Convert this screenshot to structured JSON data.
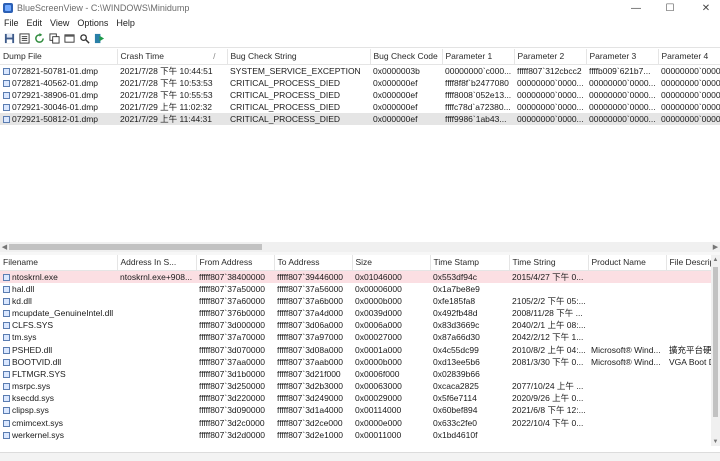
{
  "window": {
    "title": "BlueScreenView  -  C:\\WINDOWS\\Minidump"
  },
  "menu": [
    "File",
    "Edit",
    "View",
    "Options",
    "Help"
  ],
  "toolbar_icons": [
    "save-icon",
    "properties-icon",
    "refresh-icon",
    "copy-icon",
    "html-report-icon",
    "search-icon",
    "exit-icon"
  ],
  "crash_table": {
    "columns": [
      "Dump File",
      "Crash Time",
      "Bug Check String",
      "Bug Check Code",
      "Parameter 1",
      "Parameter 2",
      "Parameter 3",
      "Parameter 4"
    ],
    "sort_indicator": "/",
    "rows": [
      [
        "072821-50781-01.dmp",
        "2021/7/28 下午 10:44:51",
        "SYSTEM_SERVICE_EXCEPTION",
        "0x0000003b",
        "00000000`c000...",
        "fffff807`312cbcc2",
        "ffffb009`621b7...",
        "00000000`0000..."
      ],
      [
        "072821-40562-01.dmp",
        "2021/7/28 下午 10:53:53",
        "CRITICAL_PROCESS_DIED",
        "0x000000ef",
        "ffff8f8f`b2477080",
        "00000000`0000...",
        "00000000`0000...",
        "00000000`0000..."
      ],
      [
        "072921-38906-01.dmp",
        "2021/7/28 下午 10:55:53",
        "CRITICAL_PROCESS_DIED",
        "0x000000ef",
        "ffff8008`052e13...",
        "00000000`0000...",
        "00000000`0000...",
        "00000000`0000..."
      ],
      [
        "072921-30046-01.dmp",
        "2021/7/29 上午 11:02:32",
        "CRITICAL_PROCESS_DIED",
        "0x000000ef",
        "ffffc78d`a72380...",
        "00000000`0000...",
        "00000000`0000...",
        "00000000`0000..."
      ],
      [
        "072921-50812-01.dmp",
        "2021/7/29 上午 11:44:31",
        "CRITICAL_PROCESS_DIED",
        "0x000000ef",
        "ffff9986`1ab43...",
        "00000000`0000...",
        "00000000`0000...",
        "00000000`0000..."
      ]
    ],
    "selected_row": 4
  },
  "driver_table": {
    "columns": [
      "Filename",
      "Address In S...",
      "From Address",
      "To Address",
      "Size",
      "Time Stamp",
      "Time String",
      "Product Name",
      "File Descrip..."
    ],
    "rows": [
      [
        "ntoskrnl.exe",
        "ntoskrnl.exe+908...",
        "fffff807`38400000",
        "fffff807`39446000",
        "0x01046000",
        "0x553df94c",
        "2015/4/27 下午 0...",
        "",
        ""
      ],
      [
        "hal.dll",
        "",
        "fffff807`37a50000",
        "fffff807`37a56000",
        "0x00006000",
        "0x1a7be8e9",
        "",
        "",
        ""
      ],
      [
        "kd.dll",
        "",
        "fffff807`37a60000",
        "fffff807`37a6b000",
        "0x0000b000",
        "0xfe185fa8",
        "2105/2/2 下午 05:...",
        "",
        ""
      ],
      [
        "mcupdate_GenuineIntel.dll",
        "",
        "fffff807`376b0000",
        "fffff807`37a4d000",
        "0x0039d000",
        "0x492fb48d",
        "2008/11/28 下午 ...",
        "",
        ""
      ],
      [
        "CLFS.SYS",
        "",
        "fffff807`3d000000",
        "fffff807`3d06a000",
        "0x0006a000",
        "0x83d3669c",
        "2040/2/1 上午 08:...",
        "",
        ""
      ],
      [
        "tm.sys",
        "",
        "fffff807`37a70000",
        "fffff807`37a97000",
        "0x00027000",
        "0x87a66d30",
        "2042/2/12 下午 1...",
        "",
        ""
      ],
      [
        "PSHED.dll",
        "",
        "fffff807`3d070000",
        "fffff807`3d08a000",
        "0x0001a000",
        "0x4c55dc99",
        "2010/8/2 上午 04:...",
        "Microsoft® Wind...",
        "擴充平台硬體"
      ],
      [
        "BOOTVID.dll",
        "",
        "fffff807`37aa0000",
        "fffff807`37aab000",
        "0x0000b000",
        "0xd13ee5b6",
        "2081/3/30 下午 0...",
        "Microsoft® Wind...",
        "VGA Boot Dr..."
      ],
      [
        "FLTMGR.SYS",
        "",
        "fffff807`3d1b0000",
        "fffff807`3d21f000",
        "0x0006f000",
        "0x02839b66",
        "",
        "",
        ""
      ],
      [
        "msrpc.sys",
        "",
        "fffff807`3d250000",
        "fffff807`3d2b3000",
        "0x00063000",
        "0xcaca2825",
        "2077/10/24 上午 ...",
        "",
        ""
      ],
      [
        "ksecdd.sys",
        "",
        "fffff807`3d220000",
        "fffff807`3d249000",
        "0x00029000",
        "0x5f6e7114",
        "2020/9/26 上午 0...",
        "",
        ""
      ],
      [
        "clipsp.sys",
        "",
        "fffff807`3d090000",
        "fffff807`3d1a4000",
        "0x00114000",
        "0x60bef894",
        "2021/6/8 下午 12:...",
        "",
        ""
      ],
      [
        "cmimcext.sys",
        "",
        "fffff807`3d2c0000",
        "fffff807`3d2ce000",
        "0x0000e000",
        "0x633c2fe0",
        "2022/10/4 下午 0...",
        "",
        ""
      ],
      [
        "werkernel.sys",
        "",
        "fffff807`3d2d0000",
        "fffff807`3d2e1000",
        "0x00011000",
        "0x1bd4610f",
        "",
        "",
        ""
      ]
    ],
    "highlighted_row": 0
  },
  "status": {
    "text": ""
  }
}
